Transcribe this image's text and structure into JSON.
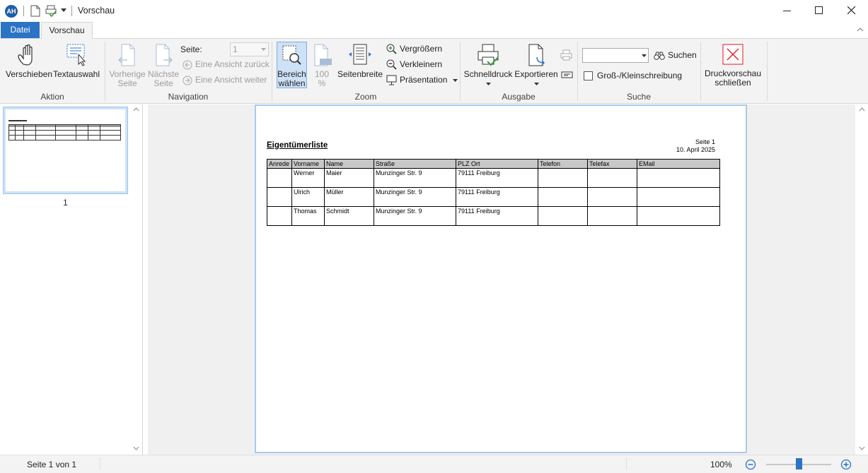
{
  "window": {
    "avatar": "AH",
    "title": "Vorschau"
  },
  "tabs": {
    "file": "Datei",
    "preview": "Vorschau"
  },
  "ribbon": {
    "aktion": {
      "label": "Aktion",
      "move": "Verschieben",
      "text_select": "Textauswahl"
    },
    "navigation": {
      "label": "Navigation",
      "prev_line1": "Vorherige",
      "prev_line2": "Seite",
      "next_line1": "Nächste",
      "next_line2": "Seite",
      "page_label": "Seite:",
      "page_value": "1",
      "view_back": "Eine Ansicht zurück",
      "view_forward": "Eine Ansicht weiter"
    },
    "zoom": {
      "label": "Zoom",
      "select_area_line1": "Bereich",
      "select_area_line2": "wählen",
      "hundred_line1": "100",
      "hundred_line2": "%",
      "page_width": "Seitenbreite",
      "zoom_in": "Vergrößern",
      "zoom_out": "Verkleinern",
      "presentation": "Präsentation"
    },
    "ausgabe": {
      "label": "Ausgabe",
      "quick_print": "Schnelldruck",
      "export": "Exportieren"
    },
    "suche": {
      "label": "Suche",
      "search_value": "",
      "search_button": "Suchen",
      "case_sensitive": "Groß-/Kleinschreibung",
      "case_checked": false
    },
    "close": {
      "line1": "Druckvorschau",
      "line2": "schließen"
    }
  },
  "thumbnails": {
    "page_number": "1"
  },
  "document": {
    "title": "Eigentümerliste",
    "page": "Seite 1",
    "date": "10. April 2025",
    "columns": [
      "Anrede",
      "Vorname",
      "Name",
      "Straße",
      "PLZ Ort",
      "Telefon",
      "Telefax",
      "EMail"
    ],
    "rows": [
      [
        "",
        "Werner",
        "Maier",
        "Munzinger Str. 9",
        "79111 Freiburg",
        "",
        "",
        ""
      ],
      [
        "",
        "Ulrich",
        "Müller",
        "Munzinger Str. 9",
        "79111 Freiburg",
        "",
        "",
        ""
      ],
      [
        "",
        "Thomas",
        "Schmidt",
        "Munzinger Str. 9",
        "79111 Freiburg",
        "",
        "",
        ""
      ]
    ]
  },
  "status": {
    "page_info": "Seite 1 von 1",
    "zoom": "100%",
    "zoom_fraction": 0.5
  },
  "colors": {
    "accent": "#2b73c5",
    "close_red": "#e81123"
  }
}
